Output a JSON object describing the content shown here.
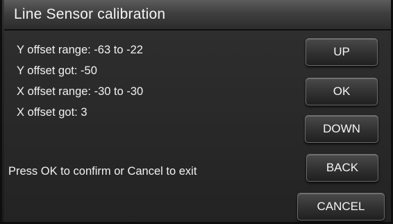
{
  "window": {
    "title": "Line Sensor calibration"
  },
  "info": {
    "y_offset_range": "Y offset range: -63 to -22",
    "y_offset_got": "Y offset got: -50",
    "x_offset_range": "X offset range: -30 to -30",
    "x_offset_got": "X offset got: 3"
  },
  "prompt": "Press OK to confirm or Cancel to exit",
  "buttons": {
    "up": "UP",
    "ok": "OK",
    "down": "DOWN",
    "back": "BACK",
    "cancel": "CANCEL"
  }
}
